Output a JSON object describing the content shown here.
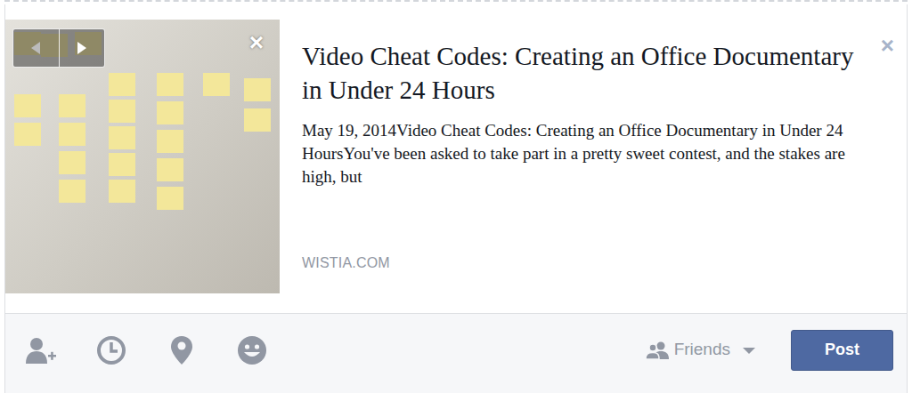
{
  "preview": {
    "image_close": "×",
    "title": "Video Cheat Codes: Creating an Office Documentary in Under 24 Hours",
    "description": "May 19, 2014Video Cheat Codes: Creating an Office Documentary in Under 24 HoursYou've been asked to take part in a pretty sweet contest, and the stakes are high, but",
    "domain": "WISTIA.COM",
    "close": "×"
  },
  "toolbar": {
    "audience": "Friends",
    "post": "Post"
  }
}
